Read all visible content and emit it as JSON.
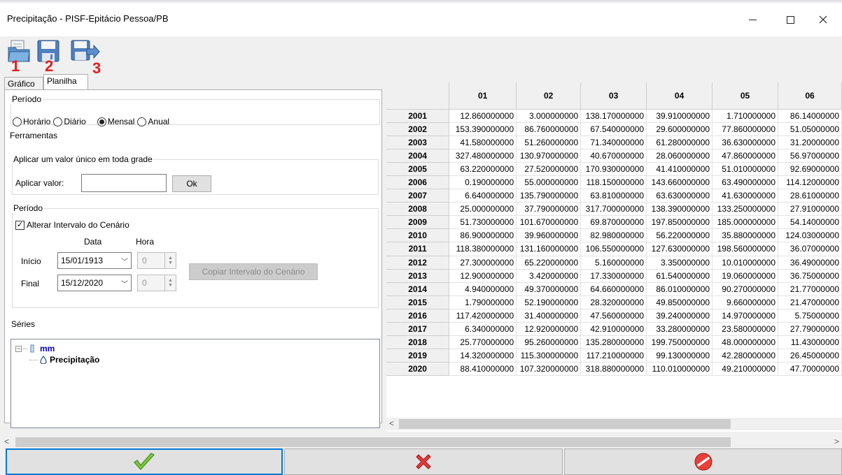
{
  "window": {
    "title": "Precipitação - PISF-Epitácio Pessoa/PB",
    "minimize": "—",
    "maximize": "□",
    "close": "✕"
  },
  "toolbar": {
    "buttons": [
      {
        "icon": "open-file-icon",
        "annotation": "1"
      },
      {
        "icon": "save-icon",
        "annotation": "2"
      },
      {
        "icon": "export-icon",
        "annotation": "3"
      }
    ]
  },
  "tabs": [
    "Gráfico",
    "Planilha"
  ],
  "periodo_group": {
    "legend": "Período",
    "options": [
      "Horário",
      "Diário",
      "Mensal",
      "Anual"
    ],
    "selected": "Mensal"
  },
  "ferramentas": {
    "legend": "Ferramentas",
    "aplicar_group": {
      "legend": "Aplicar um valor único em toda grade",
      "label": "Aplicar valor:",
      "value": "",
      "ok_label": "Ok"
    },
    "periodo": {
      "legend": "Período",
      "checkbox_label": "Alterar Intervalo do Cenário",
      "checked": true,
      "col_data": "Data",
      "col_hora": "Hora",
      "inicio_label": "Início",
      "inicio_date": "15/01/1913",
      "inicio_hour": "0",
      "final_label": "Final",
      "final_date": "15/12/2020",
      "final_hour": "0",
      "copy_button": "Copiar Intervalo do Cenário"
    }
  },
  "series": {
    "legend": "Séries",
    "root": "mm",
    "child": "Precipitação"
  },
  "grid": {
    "columns": [
      "01",
      "02",
      "03",
      "04",
      "05",
      "06"
    ],
    "rows": [
      {
        "year": "2001",
        "values": [
          "12.860000000",
          "3.000000000",
          "138.170000000",
          "39.910000000",
          "1.710000000",
          "86.14000000"
        ]
      },
      {
        "year": "2002",
        "values": [
          "153.390000000",
          "86.760000000",
          "67.540000000",
          "29.600000000",
          "77.860000000",
          "51.05000000"
        ]
      },
      {
        "year": "2003",
        "values": [
          "41.580000000",
          "51.260000000",
          "71.340000000",
          "61.280000000",
          "36.630000000",
          "31.20000000"
        ]
      },
      {
        "year": "2004",
        "values": [
          "327.480000000",
          "130.970000000",
          "40.670000000",
          "28.060000000",
          "47.860000000",
          "56.97000000"
        ]
      },
      {
        "year": "2005",
        "values": [
          "63.220000000",
          "27.520000000",
          "170.930000000",
          "41.410000000",
          "51.010000000",
          "92.69000000"
        ]
      },
      {
        "year": "2006",
        "values": [
          "0.190000000",
          "55.000000000",
          "118.150000000",
          "143.660000000",
          "63.490000000",
          "114.12000000"
        ]
      },
      {
        "year": "2007",
        "values": [
          "6.640000000",
          "135.790000000",
          "63.810000000",
          "63.630000000",
          "41.630000000",
          "28.61000000"
        ]
      },
      {
        "year": "2008",
        "values": [
          "25.000000000",
          "37.790000000",
          "317.700000000",
          "138.390000000",
          "133.250000000",
          "27.91000000"
        ]
      },
      {
        "year": "2009",
        "values": [
          "51.730000000",
          "101.670000000",
          "69.870000000",
          "197.850000000",
          "185.000000000",
          "54.14000000"
        ]
      },
      {
        "year": "2010",
        "values": [
          "86.900000000",
          "39.960000000",
          "82.980000000",
          "56.220000000",
          "35.880000000",
          "124.03000000"
        ]
      },
      {
        "year": "2011",
        "values": [
          "118.380000000",
          "131.160000000",
          "106.550000000",
          "127.630000000",
          "198.560000000",
          "36.07000000"
        ]
      },
      {
        "year": "2012",
        "values": [
          "27.300000000",
          "65.220000000",
          "5.160000000",
          "3.350000000",
          "10.010000000",
          "36.49000000"
        ]
      },
      {
        "year": "2013",
        "values": [
          "12.900000000",
          "3.420000000",
          "17.330000000",
          "61.540000000",
          "19.060000000",
          "36.75000000"
        ]
      },
      {
        "year": "2014",
        "values": [
          "4.940000000",
          "49.370000000",
          "64.660000000",
          "86.010000000",
          "90.270000000",
          "21.77000000"
        ]
      },
      {
        "year": "2015",
        "values": [
          "1.790000000",
          "52.190000000",
          "28.320000000",
          "49.850000000",
          "9.660000000",
          "21.47000000"
        ]
      },
      {
        "year": "2016",
        "values": [
          "117.420000000",
          "31.400000000",
          "47.560000000",
          "39.240000000",
          "14.970000000",
          "5.75000000"
        ]
      },
      {
        "year": "2017",
        "values": [
          "6.340000000",
          "12.920000000",
          "42.910000000",
          "33.280000000",
          "23.580000000",
          "27.79000000"
        ]
      },
      {
        "year": "2018",
        "values": [
          "25.770000000",
          "95.260000000",
          "135.280000000",
          "199.750000000",
          "48.000000000",
          "11.43000000"
        ]
      },
      {
        "year": "2019",
        "values": [
          "14.320000000",
          "115.300000000",
          "117.210000000",
          "99.130000000",
          "42.280000000",
          "26.45000000"
        ]
      },
      {
        "year": "2020",
        "values": [
          "88.410000000",
          "107.320000000",
          "318.880000000",
          "110.010000000",
          "49.210000000",
          "47.70000000"
        ]
      }
    ]
  },
  "actions": {
    "ok_icon": "green-check-icon",
    "cancel_icon": "red-x-icon",
    "block_icon": "red-no-entry-icon"
  },
  "colors": {
    "annotation_red": "#e02020",
    "focus_blue": "#0078d7",
    "tree_blue": "#0000c8"
  }
}
